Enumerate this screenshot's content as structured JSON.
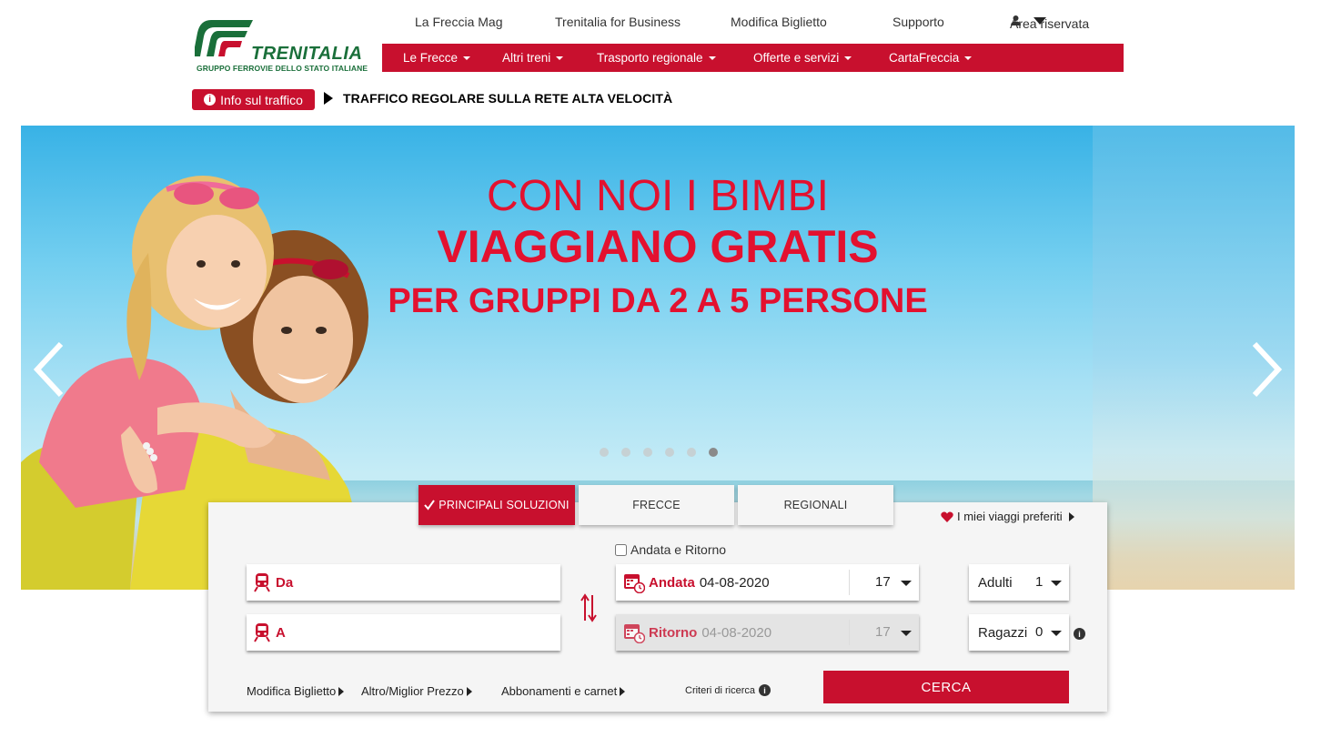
{
  "brand": {
    "name": "TRENITALIA",
    "subtitle": "GRUPPO FERROVIE DELLO STATO ITALIANE",
    "color_green": "#1a6f3a",
    "color_red": "#c8102e"
  },
  "top_nav": {
    "items": [
      "La Freccia Mag",
      "Trenitalia for Business",
      "Modifica Biglietto",
      "Supporto"
    ],
    "account": "Area riservata",
    "account_icon": "user-icon"
  },
  "main_nav": {
    "items": [
      "Le Frecce",
      "Altri treni",
      "Trasporto regionale",
      "Offerte e servizi",
      "CartaFreccia"
    ]
  },
  "traffic": {
    "button": "Info sul traffico",
    "message": "TRAFFICO REGOLARE SULLA RETE ALTA VELOCITÀ"
  },
  "hero": {
    "line1": "CON NOI I BIMBI",
    "line2": "VIAGGIANO GRATIS",
    "line3": "PER GRUPPI DA 2 A 5 PERSONE",
    "slides_total": 6,
    "active_slide": 6
  },
  "search": {
    "tabs": [
      "PRINCIPALI SOLUZIONI",
      "FRECCE",
      "REGIONALI"
    ],
    "active_tab": 0,
    "favorites": "I miei viaggi preferiti",
    "round_trip_label": "Andata e Ritorno",
    "from_label": "Da",
    "to_label": "A",
    "departure_label": "Andata",
    "departure_date": "04-08-2020",
    "departure_hour": "17",
    "return_label": "Ritorno",
    "return_date": "04-08-2020",
    "return_hour": "17",
    "adults_label": "Adulti",
    "adults_value": "1",
    "kids_label": "Ragazzi",
    "kids_value": "0",
    "links": [
      "Modifica Biglietto",
      "Altro/Miglior Prezzo",
      "Abbonamenti e carnet"
    ],
    "criteria": "Criteri di ricerca",
    "search_button": "CERCA"
  }
}
